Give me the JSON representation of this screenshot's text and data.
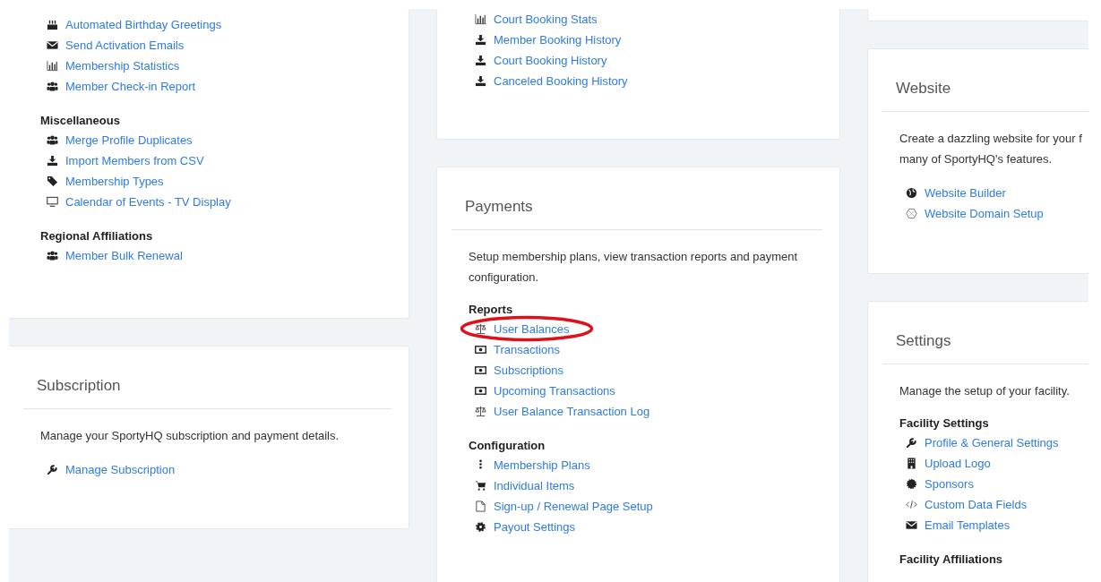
{
  "columns": [
    {
      "cards": [
        {
          "sections": [
            {
              "links": [
                {
                  "label": "Automated Birthday Greetings",
                  "kind": "cake"
                },
                {
                  "label": "Send Activation Emails",
                  "kind": "envelope"
                },
                {
                  "label": "Membership Statistics",
                  "kind": "chart"
                },
                {
                  "label": "Member Check-in Report",
                  "kind": "users"
                }
              ]
            },
            {
              "heading": "Miscellaneous",
              "links": [
                {
                  "label": "Merge Profile Duplicates",
                  "kind": "users"
                },
                {
                  "label": "Import Members from CSV",
                  "kind": "download"
                },
                {
                  "label": "Membership Types",
                  "kind": "tag"
                },
                {
                  "label": "Calendar of Events - TV Display",
                  "kind": "monitor"
                }
              ]
            },
            {
              "heading": "Regional Affiliations",
              "links": [
                {
                  "label": "Member Bulk Renewal",
                  "kind": "users"
                }
              ]
            }
          ]
        },
        {
          "title": "Subscription",
          "description": "Manage your SportyHQ subscription and payment details.",
          "sections": [
            {
              "links": [
                {
                  "label": "Manage Subscription",
                  "kind": "wrench"
                }
              ]
            }
          ]
        }
      ]
    },
    {
      "cards": [
        {
          "sections": [
            {
              "links": [
                {
                  "label": "Court Booking Stats",
                  "kind": "chart"
                },
                {
                  "label": "Member Booking History",
                  "kind": "download"
                },
                {
                  "label": "Court Booking History",
                  "kind": "download"
                },
                {
                  "label": "Canceled Booking History",
                  "kind": "download"
                }
              ]
            }
          ]
        },
        {
          "title": "Payments",
          "description": "Setup membership plans, view transaction reports and payment configuration.",
          "sections": [
            {
              "heading": "Reports",
              "links": [
                {
                  "label": "User Balances",
                  "kind": "scale",
                  "highlighted": true
                },
                {
                  "label": "Transactions",
                  "kind": "money",
                  "highlighted": false
                },
                {
                  "label": "Subscriptions",
                  "kind": "money",
                  "highlighted": false
                },
                {
                  "label": "Upcoming Transactions",
                  "kind": "money",
                  "highlighted": false
                },
                {
                  "label": "User Balance Transaction Log",
                  "kind": "scale",
                  "highlighted": false
                }
              ]
            },
            {
              "heading": "Configuration",
              "links": [
                {
                  "label": "Membership Plans",
                  "kind": "dots"
                },
                {
                  "label": "Individual Items",
                  "kind": "cart"
                },
                {
                  "label": "Sign-up / Renewal Page Setup",
                  "kind": "file"
                },
                {
                  "label": "Payout Settings",
                  "kind": "gear"
                }
              ]
            }
          ]
        }
      ]
    },
    {
      "cards": [
        {
          "title": "Website",
          "description": "Create a dazzling website for your f\nmany of SportyHQ's features.",
          "sections": [
            {
              "links": [
                {
                  "label": "Website Builder",
                  "kind": "globe"
                },
                {
                  "label": "Website Domain Setup",
                  "kind": "hexagon"
                }
              ]
            }
          ]
        },
        {
          "title": "Settings",
          "description": "Manage the setup of your facility.",
          "sections": [
            {
              "heading": "Facility Settings",
              "links": [
                {
                  "label": "Profile & General Settings",
                  "kind": "wrench"
                },
                {
                  "label": "Upload Logo",
                  "kind": "building"
                },
                {
                  "label": "Sponsors",
                  "kind": "badge"
                },
                {
                  "label": "Custom Data Fields",
                  "kind": "code"
                },
                {
                  "label": "Email Templates",
                  "kind": "envelope"
                }
              ]
            },
            {
              "heading": "Facility Affiliations"
            }
          ]
        }
      ]
    }
  ]
}
